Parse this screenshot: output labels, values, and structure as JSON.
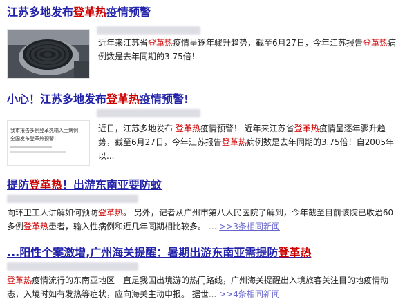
{
  "results": [
    {
      "title_pre": "江苏多地发布",
      "title_hl": "登革热",
      "title_post": "疫情预警",
      "snippet": [
        {
          "t": "近年来江苏省"
        },
        {
          "t": "登革热",
          "hl": true
        },
        {
          "t": "疫情呈逐年骤升趋势，截至6月27日，今年江苏报告"
        },
        {
          "t": "登革热",
          "hl": true
        },
        {
          "t": "病例数是去年同期的3.75倍！"
        }
      ]
    },
    {
      "title_pre": "小心！江苏多地发布",
      "title_hl": "登革热",
      "title_post": "疫情预警!",
      "thumb_text": [
        "我市报告多例登革热输入士病例",
        "全国发布登革热预警！"
      ],
      "snippet": [
        {
          "t": "近日，江苏多地发布 "
        },
        {
          "t": "登革热",
          "hl": true
        },
        {
          "t": "疫情预警！ 近年来江苏省"
        },
        {
          "t": "登革热",
          "hl": true
        },
        {
          "t": "疫情呈逐年骤升趋势，截至6月27日，今年江苏报告"
        },
        {
          "t": "登革热",
          "hl": true
        },
        {
          "t": "病例数是去年同期的3.75倍！自2005年以..."
        }
      ]
    },
    {
      "title_pre": "提防",
      "title_hl": "登革热",
      "title_post": "！出游东南亚要防蚊",
      "snippet": [
        {
          "t": "向环卫工人讲解如何预防"
        },
        {
          "t": "登革热",
          "hl": true
        },
        {
          "t": "。 另外，记者从广州市第八人民医院了解到，今年截至目前该院已收治60多例"
        },
        {
          "t": "登革热",
          "hl": true
        },
        {
          "t": "患者，输入性病例和近几年同期相比较多。"
        }
      ],
      "more": ">>3条相同新闻"
    },
    {
      "title_pre": "...阳性个案激增,广州海关提醒：暑期出游东南亚需提防",
      "title_hl": "登革热",
      "title_post": "",
      "snippet": [
        {
          "t": "登革热",
          "hl": true
        },
        {
          "t": "疫情流行的东南亚地区一直是我国出境游的热门路线，广州海关提醒出入境旅客关注目的地疫情动态，入境时如有发热等症状，应向海关主动申报。 据世"
        }
      ],
      "more": ">>4条相同新闻"
    }
  ]
}
